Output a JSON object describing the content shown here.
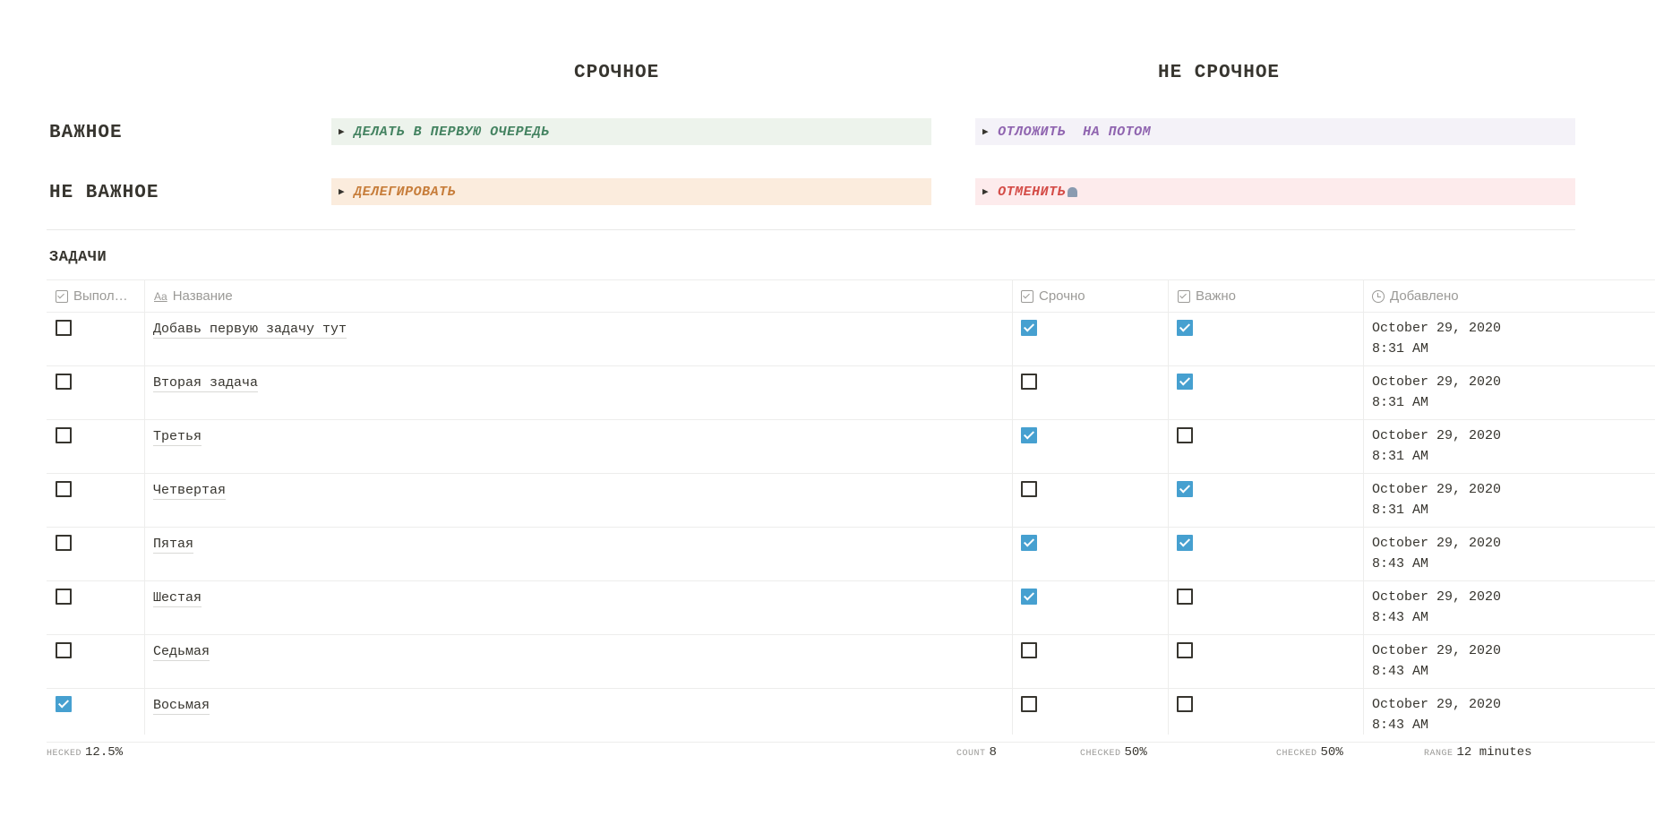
{
  "matrix": {
    "col_urgent": "СРОЧНОЕ",
    "col_not_urgent": "НЕ СРОЧНОЕ",
    "row_important": "ВАЖНОЕ",
    "row_not_important": "НЕ ВАЖНОЕ",
    "q1": {
      "label": "ДЕЛАТЬ В ПЕРВУЮ ОЧЕРЕДЬ",
      "bg": "#edf3ec",
      "color": "#448361"
    },
    "q2": {
      "label": "ОТЛОЖИТЬ  НА ПОТОМ",
      "bg": "#f4f2f8",
      "color": "#9065b0"
    },
    "q3": {
      "label": "ДЕЛЕГИРОВАТЬ",
      "bg": "#fbecdd",
      "color": "#c77d3a"
    },
    "q4": {
      "label": "ОТМЕНИТЬ",
      "bg": "#fdebec",
      "color": "#d44c47",
      "icon": "tombstone-icon"
    }
  },
  "tasks": {
    "title": "ЗАДАЧИ",
    "columns": {
      "done": "Выпол…",
      "name": "Название",
      "urgent": "Срочно",
      "important": "Важно",
      "added": "Добавлено"
    },
    "rows": [
      {
        "done": false,
        "name": "Добавь первую задачу тут",
        "urgent": true,
        "important": true,
        "date": "October 29, 2020",
        "time": "8:31 AM"
      },
      {
        "done": false,
        "name": "Вторая задача",
        "urgent": false,
        "important": true,
        "date": "October 29, 2020",
        "time": "8:31 AM"
      },
      {
        "done": false,
        "name": "Третья",
        "urgent": true,
        "important": false,
        "date": "October 29, 2020",
        "time": "8:31 AM"
      },
      {
        "done": false,
        "name": "Четвертая",
        "urgent": false,
        "important": true,
        "date": "October 29, 2020",
        "time": "8:31 AM"
      },
      {
        "done": false,
        "name": "Пятая",
        "urgent": true,
        "important": true,
        "date": "October 29, 2020",
        "time": "8:43 AM"
      },
      {
        "done": false,
        "name": "Шестая",
        "urgent": true,
        "important": false,
        "date": "October 29, 2020",
        "time": "8:43 AM"
      },
      {
        "done": false,
        "name": "Седьмая",
        "urgent": false,
        "important": false,
        "date": "October 29, 2020",
        "time": "8:43 AM"
      },
      {
        "done": true,
        "name": "Восьмая",
        "urgent": false,
        "important": false,
        "date": "October 29, 2020",
        "time": "8:43 AM"
      }
    ],
    "footer": {
      "done_label": "HECKED",
      "done_value": "12.5%",
      "count_label": "COUNT",
      "count_value": "8",
      "urgent_label": "CHECKED",
      "urgent_value": "50%",
      "important_label": "CHECKED",
      "important_value": "50%",
      "range_label": "RANGE",
      "range_value": "12 minutes"
    }
  }
}
